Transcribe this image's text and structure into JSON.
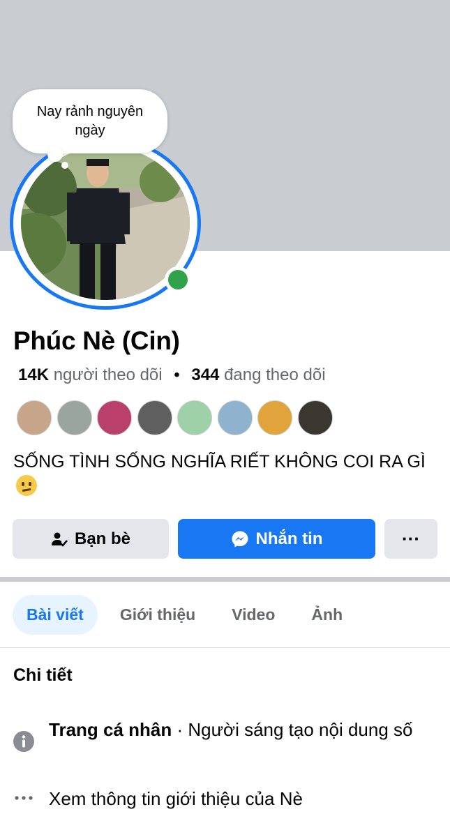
{
  "profile": {
    "note_bubble": "Nay rảnh nguyên ngày",
    "name": "Phúc Nè (Cin)",
    "followers_count": "14K",
    "followers_label": "người theo dõi",
    "separator": "•",
    "following_count": "344",
    "following_label": "đang theo dõi",
    "bio_text": "SỐNG TÌNH SỐNG NGHĨA RIẾT KHÔNG COI RA GÌ",
    "bio_emoji": "confused-face-emoji",
    "online_status_color": "#31a24c"
  },
  "friend_avatars": [
    {
      "name": "friend-avatar-1",
      "color": "#c7a58a"
    },
    {
      "name": "friend-avatar-2",
      "color": "#9aa5a0"
    },
    {
      "name": "friend-avatar-3",
      "color": "#b8406a"
    },
    {
      "name": "friend-avatar-4",
      "color": "#5f5f5f"
    },
    {
      "name": "friend-avatar-5",
      "color": "#9fd1a8"
    },
    {
      "name": "friend-avatar-6",
      "color": "#8fb2cf"
    },
    {
      "name": "friend-avatar-7",
      "color": "#e0a43a"
    },
    {
      "name": "friend-avatar-8",
      "color": "#3a3630"
    }
  ],
  "actions": {
    "friends_label": "Bạn bè",
    "message_label": "Nhắn tin",
    "more_label": "···"
  },
  "tabs": [
    {
      "label": "Bài viết",
      "active": true
    },
    {
      "label": "Giới thiệu",
      "active": false
    },
    {
      "label": "Video",
      "active": false
    },
    {
      "label": "Ảnh",
      "active": false
    }
  ],
  "details": {
    "title": "Chi tiết",
    "page_type_bold": "Trang cá nhân",
    "page_type_rest": " · Người sáng tạo nội dung số",
    "see_more": "Xem thông tin giới thiệu của Nè"
  },
  "colors": {
    "accent": "#1877f2",
    "cover": "#c9ccd1",
    "button_gray": "#e4e6eb"
  }
}
